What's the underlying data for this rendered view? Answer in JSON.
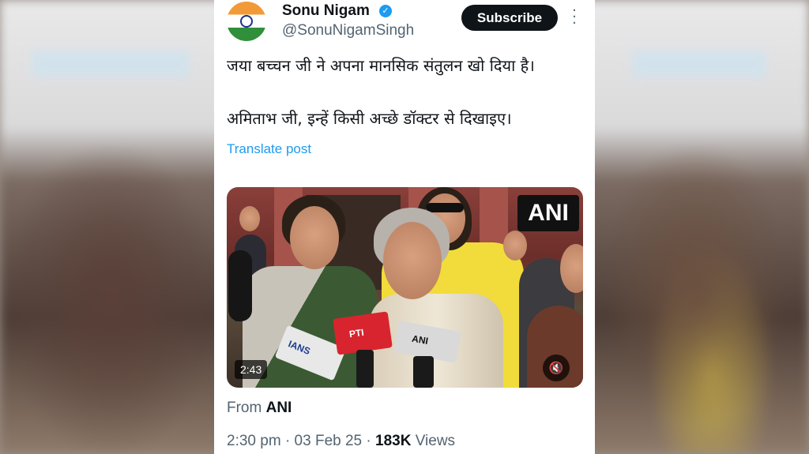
{
  "author": {
    "name": "Sonu Nigam",
    "handle": "@SonuNigamSingh",
    "verified_icon": "verified-badge-icon"
  },
  "subscribe_label": "Subscribe",
  "more_icon": "ellipsis-vertical-icon",
  "tweet": {
    "line1": "जया बच्चन जी ने अपना मानसिक संतुलन खो दिया है।",
    "line2": "अमिताभ जी, इन्हें किसी अच्छे डॉक्टर से दिखाइए।"
  },
  "translate_label": "Translate post",
  "video": {
    "watermark": "ANI",
    "duration": "2:43",
    "mute_icon": "speaker-muted-icon",
    "mics": [
      "IANS",
      "PTI",
      "ANI"
    ]
  },
  "source": {
    "prefix": "From",
    "name": "ANI"
  },
  "meta": {
    "time": "2:30 pm",
    "date": "03 Feb 25",
    "views_count": "183K",
    "views_label": "Views"
  },
  "colors": {
    "accent": "#1d9bf0",
    "text": "#0f1419",
    "secondary": "#536471"
  }
}
